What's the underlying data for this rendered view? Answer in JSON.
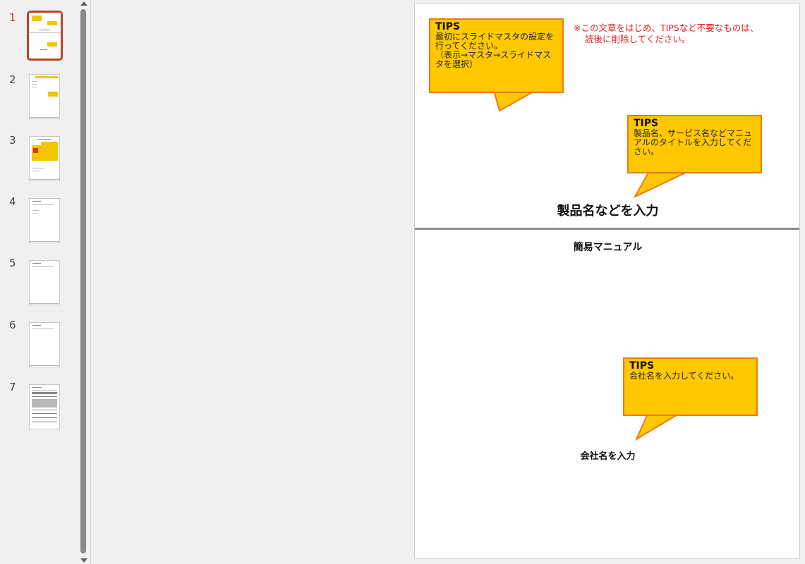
{
  "thumbnails": {
    "active_index": 1,
    "items": [
      {
        "number": "1"
      },
      {
        "number": "2"
      },
      {
        "number": "3"
      },
      {
        "number": "4"
      },
      {
        "number": "5"
      },
      {
        "number": "6"
      },
      {
        "number": "7"
      }
    ]
  },
  "slide": {
    "note_line1": "※この文章をはじめ、TIPSなど不要なものは、",
    "note_line2": "読後に削除してください。",
    "tips1": {
      "title": "TIPS",
      "line1": "最初にスライドマスタの設定を",
      "line2": "行ってください。",
      "line3": "（表示→マスタ→スライドマス",
      "line4": "タを選択）"
    },
    "tips2": {
      "title": "TIPS",
      "line1": "製品名、サービス名などマニュ",
      "line2": "アルのタイトルを入力してくだ",
      "line3": "さい。"
    },
    "tips3": {
      "title": "TIPS",
      "line1": "会社名を入力してください。"
    },
    "title": "製品名などを入力",
    "subtitle": "簡易マニュアル",
    "company": "会社名を入力"
  },
  "colors": {
    "accent_active": "#b5452b",
    "callout_fill": "#ffc800",
    "callout_border": "#f07818",
    "note_red": "#e02020"
  }
}
